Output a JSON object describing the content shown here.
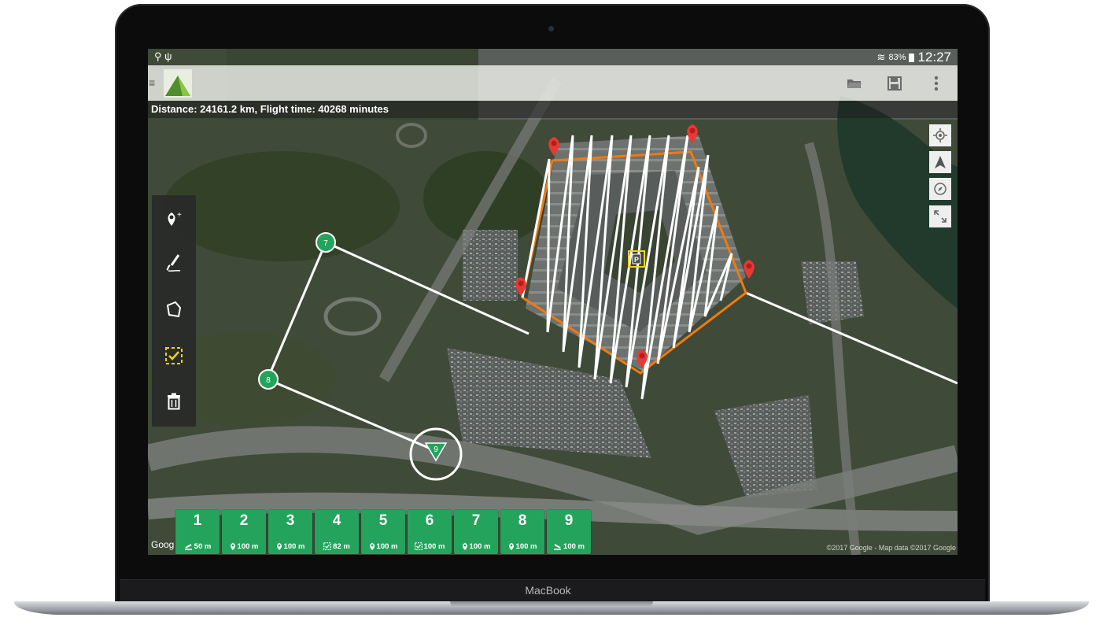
{
  "device": {
    "brand": "MacBook"
  },
  "status_bar": {
    "clock": "12:27",
    "battery": "83%"
  },
  "info": {
    "text": "Distance: 24161.2 km, Flight time: 40268 minutes"
  },
  "map": {
    "google_logo": "Goog",
    "copyright": "©2017 Google - Map data ©2017 Google"
  },
  "markers": [
    {
      "label": "7"
    },
    {
      "label": "8"
    },
    {
      "label": "9"
    }
  ],
  "waypoints": [
    {
      "num": "1",
      "icon": "takeoff-icon",
      "alt": "50 m"
    },
    {
      "num": "2",
      "icon": "waypoint-pin-icon",
      "alt": "100 m"
    },
    {
      "num": "3",
      "icon": "waypoint-pin-icon",
      "alt": "100 m"
    },
    {
      "num": "4",
      "icon": "survey-icon",
      "alt": "82 m"
    },
    {
      "num": "5",
      "icon": "waypoint-pin-icon",
      "alt": "100 m"
    },
    {
      "num": "6",
      "icon": "survey-icon",
      "alt": "100 m"
    },
    {
      "num": "7",
      "icon": "waypoint-pin-icon",
      "alt": "100 m"
    },
    {
      "num": "8",
      "icon": "waypoint-pin-icon",
      "alt": "100 m"
    },
    {
      "num": "9",
      "icon": "land-icon",
      "alt": "100 m"
    }
  ],
  "colors": {
    "waypoint": "#24a35c",
    "survey_outline": "#f07a12",
    "marker_red": "#e53935",
    "selection": "#f2d21b"
  }
}
